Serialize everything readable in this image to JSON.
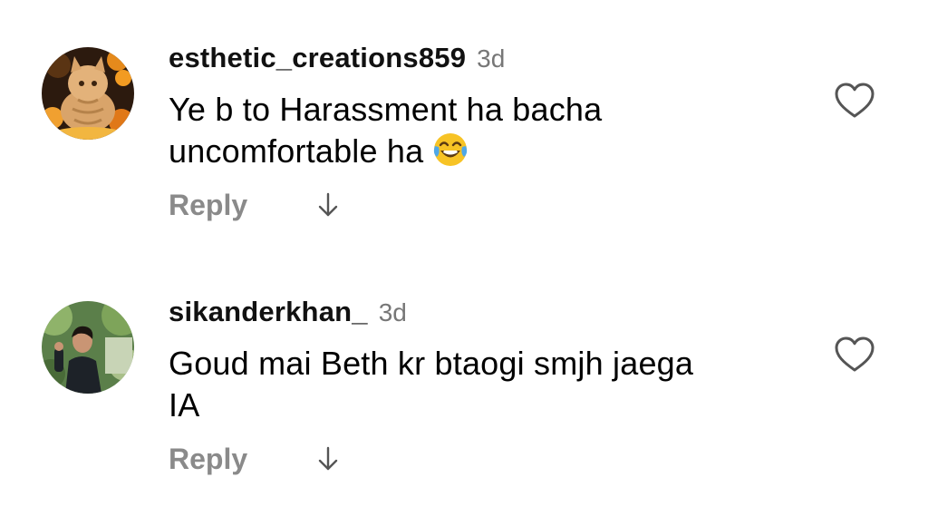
{
  "comments": [
    {
      "username": "esthetic_creations859",
      "time": "3d",
      "text": "Ye b to Harassment ha bacha\nuncomfortable ha",
      "emoji": "face-with-tears-of-joy-icon",
      "reply_label": "Reply"
    },
    {
      "username": "sikanderkhan_",
      "time": "3d",
      "text": "Goud mai Beth kr btaogi smjh jaega\nIA",
      "reply_label": "Reply"
    }
  ],
  "colors": {
    "username": "#111111",
    "time": "#777777",
    "reply": "#8a8a8a",
    "icon": "#555555"
  }
}
